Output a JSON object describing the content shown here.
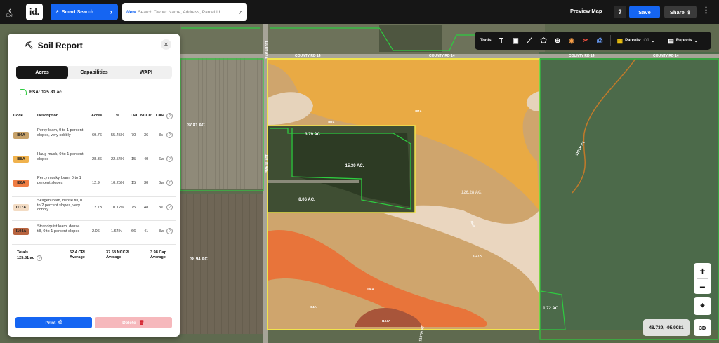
{
  "topbar": {
    "exit_label": "Exit",
    "logo_text": "id.",
    "smart_search_label": "Smart Search",
    "search_new_tag": "New",
    "search_placeholder": "Search Owner Name, Address, Parcel Id",
    "preview_map_label": "Preview Map",
    "help_label": "?",
    "save_label": "Save",
    "share_label": "Share"
  },
  "toolbar": {
    "tools_label": "Tools",
    "parcels_label": "Parcels:",
    "parcels_state": "Off",
    "reports_label": "Reports"
  },
  "map": {
    "road_labels": [
      "COUNTY RD 14",
      "COUNTY RD 14",
      "COUNTY RD 14",
      "COUNTY RD 14",
      "110TH AVE",
      "110TH AVE",
      "110TH ST",
      "110TH ST"
    ],
    "parcel_labels": {
      "a": "37.81 AC.",
      "b": "3.79 AC.",
      "c": "15.39 AC.",
      "d": "8.06 AC.",
      "e": "38.94 AC.",
      "f": "1.72 AC.",
      "g": "126.28 AC."
    },
    "soil_labels": [
      "I84A",
      "I88A",
      "I84A",
      "I117A",
      "I86A",
      "I104A",
      "I84A"
    ],
    "colors": {
      "i84a": "#d9a443",
      "i88a": "#b98c5c",
      "i86a": "#e8743a",
      "i117a": "#efd5bd",
      "i104a": "#a8553a",
      "fsa_border": "#2ecc40",
      "field_border": "#f1e34c"
    }
  },
  "panel": {
    "title": "Soil Report",
    "tabs": [
      "Acres",
      "Capabilities",
      "WAPI"
    ],
    "fsa": "FSA: 125.81 ac",
    "headers": {
      "code": "Code",
      "description": "Description",
      "acres": "Acres",
      "percent": "%",
      "cpi": "CPI",
      "nccpi": "NCCPI",
      "cap": "CAP"
    },
    "rows": [
      {
        "code": "I84A",
        "color": "#c7a26a",
        "description": "Percy loam, 0 to 1 percent slopes, very cobbly",
        "acres": "69.76",
        "percent": "55.45%",
        "cpi": "70",
        "nccpi": "36",
        "cap": "3s"
      },
      {
        "code": "I88A",
        "color": "#f0b24d",
        "description": "Haug muck, 0 to 1 percent slopes",
        "acres": "28.36",
        "percent": "22.54%",
        "cpi": "15",
        "nccpi": "40",
        "cap": "6w"
      },
      {
        "code": "I86A",
        "color": "#ef7d43",
        "description": "Percy mucky loam, 0 to 1 percent slopes",
        "acres": "12.9",
        "percent": "10.25%",
        "cpi": "15",
        "nccpi": "30",
        "cap": "6w"
      },
      {
        "code": "I117A",
        "color": "#f3dcc4",
        "description": "Skagen loam, dense till, 0 to 2 percent slopes, very cobbly",
        "acres": "12.73",
        "percent": "10.12%",
        "cpi": "75",
        "nccpi": "48",
        "cap": "3s"
      },
      {
        "code": "I104A",
        "color": "#b8643f",
        "description": "Strandquist loam, dense till, 0 to 1 percent slopes",
        "acres": "2.06",
        "percent": "1.64%",
        "cpi": "66",
        "nccpi": "41",
        "cap": "3w"
      }
    ],
    "totals": {
      "label": "Totals",
      "acres": "125.81 ac",
      "cpi_value": "52.4 CPI",
      "cpi_caption": "Average",
      "nccpi_value": "37.58 NCCPI",
      "nccpi_caption": "Average",
      "cap_value": "3.98 Cap.",
      "cap_caption": "Average"
    },
    "print_label": "Print",
    "delete_label": "Delete"
  },
  "controls": {
    "zoom_in": "+",
    "zoom_out": "−",
    "coords": "48.739, -95.9081",
    "btn_3d": "3D"
  }
}
